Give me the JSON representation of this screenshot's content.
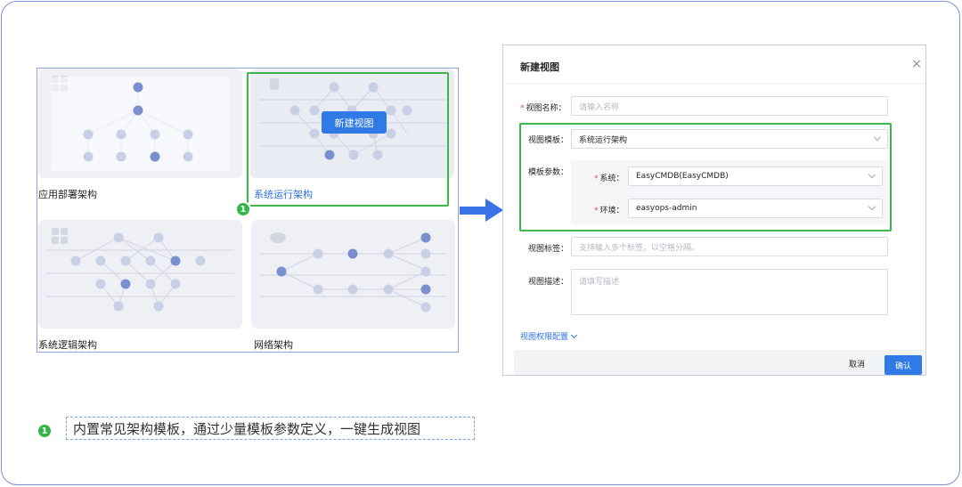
{
  "gallery": {
    "cards": [
      {
        "label": "应用部署架构",
        "active": false
      },
      {
        "label": "系统运行架构",
        "active": true
      },
      {
        "label": "系统逻辑架构",
        "active": false
      },
      {
        "label": "网络架构",
        "active": false
      }
    ],
    "hover_button": "新建视图"
  },
  "badge": "1",
  "dialog": {
    "title": "新建视图",
    "close": "×",
    "name_label": "视图名称：",
    "name_placeholder": "请输入名称",
    "template_label": "视图模板：",
    "template_value": "系统运行架构",
    "params_label": "模板参数：",
    "system_label": "系统：",
    "system_value": "EasyCMDB(EasyCMDB)",
    "env_label": "环境：",
    "env_value": "easyops-admin",
    "tags_label": "视图标签：",
    "tags_placeholder": "支持输入多个标签，以空格分隔。",
    "desc_label": "视图描述：",
    "desc_placeholder": "请填写描述",
    "perm_link": "视图权限配置",
    "cancel": "取消",
    "confirm": "确认"
  },
  "caption": "内置常见架构模板，通过少量模板参数定义，一键生成视图",
  "colors": {
    "accent": "#2f7ae6",
    "highlight_green": "#3cb549",
    "node_dark": "#7a8fcf",
    "node_light": "#c9d0e6"
  }
}
